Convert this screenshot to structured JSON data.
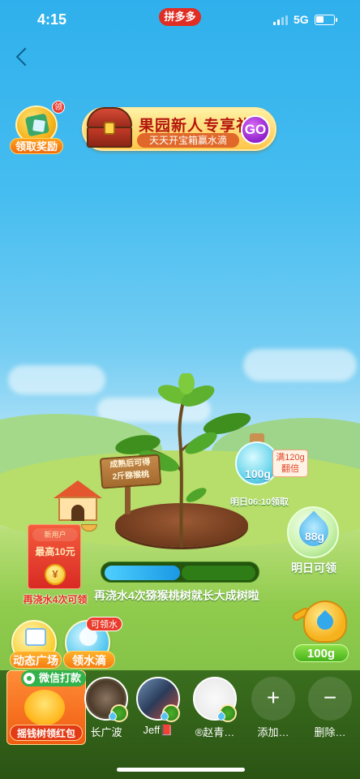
{
  "status_bar": {
    "time": "4:15",
    "network": "5G",
    "brand": "拼多多"
  },
  "reward": {
    "label": "领取奖励",
    "tag": "领"
  },
  "promo": {
    "title": "果园新人专享礼",
    "subtitle": "天天开宝箱赢水滴",
    "go_label": "GO"
  },
  "harvest_sign": {
    "line1": "成熟后可得",
    "line2": "2斤猕猴桃"
  },
  "bottle": {
    "value": "100g",
    "badge_line1": "满120g",
    "badge_line2": "翻倍",
    "caption": "明日06:10领取"
  },
  "tomorrow": {
    "value": "88g",
    "caption": "明日可领"
  },
  "new_user": {
    "tag": "新用户",
    "amount": "最高10元",
    "coin": "¥",
    "caption": "再浇水4次可领"
  },
  "growth": {
    "progress": 0.5,
    "status": "再浇水4次猕猴桃树就长大成树啦"
  },
  "actions": {
    "dynamic_label": "动态广场",
    "water_label": "领水滴",
    "water_tag": "可领水",
    "kettle_label": "100g"
  },
  "shake": {
    "wechat_tag": "微信打款",
    "label": "摇钱树领红包"
  },
  "friends": [
    {
      "name": "长广波"
    },
    {
      "name": "Jeff📕"
    },
    {
      "name": "®赵青…"
    }
  ],
  "friend_actions": {
    "add_label": "添加…",
    "add_symbol": "+",
    "delete_label": "删除…",
    "delete_symbol": "−"
  },
  "colors": {
    "sky_top": "#2fb0ec",
    "grass": "#8fcb4c",
    "accent_orange": "#f57d12",
    "brand_red": "#e02e24"
  }
}
